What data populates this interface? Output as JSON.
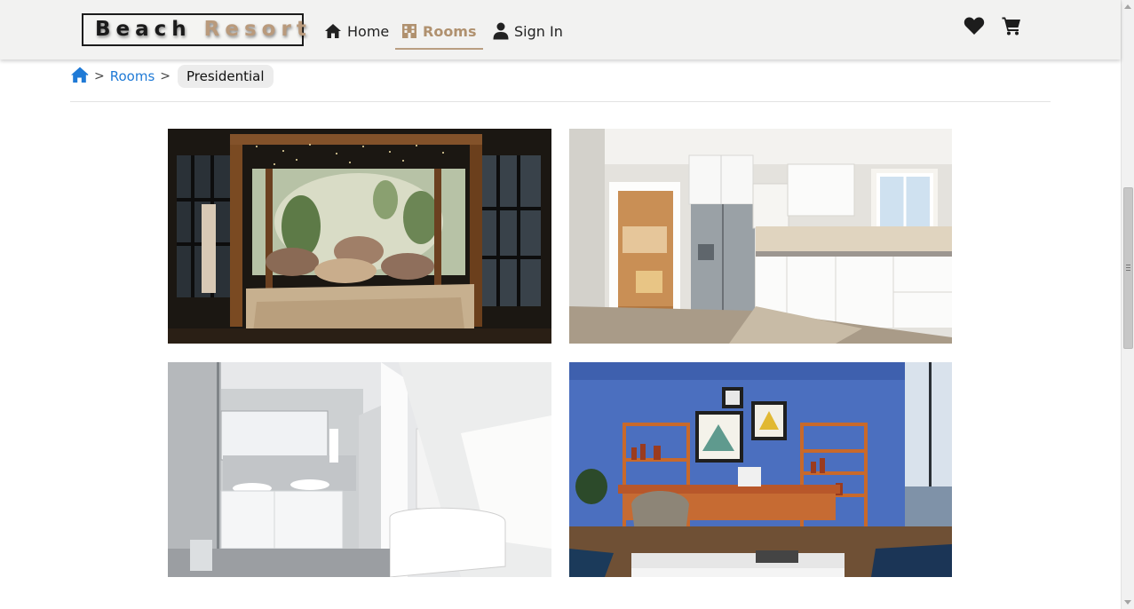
{
  "brand": {
    "word1": "Beach",
    "word2": "Resort"
  },
  "nav": {
    "home_label": "Home",
    "rooms_label": "Rooms",
    "signin_label": "Sign In",
    "active": "Rooms"
  },
  "icons": {
    "home": "home-icon",
    "rooms": "hotel-icon",
    "signin": "user-icon",
    "wishlist": "heart-icon",
    "cart": "cart-icon",
    "breadcrumb_home": "home-icon"
  },
  "breadcrumb": {
    "separator": ">",
    "rooms_label": "Rooms",
    "current_label": "Presidential"
  },
  "gallery": {
    "photos": [
      {
        "subject": "bedroom"
      },
      {
        "subject": "kitchen"
      },
      {
        "subject": "bathroom"
      },
      {
        "subject": "study"
      }
    ]
  },
  "colors": {
    "brand_accent": "#b99a7c",
    "link": "#1f7ad6",
    "navbar_bg": "#f2f2f1",
    "text": "#222222"
  }
}
